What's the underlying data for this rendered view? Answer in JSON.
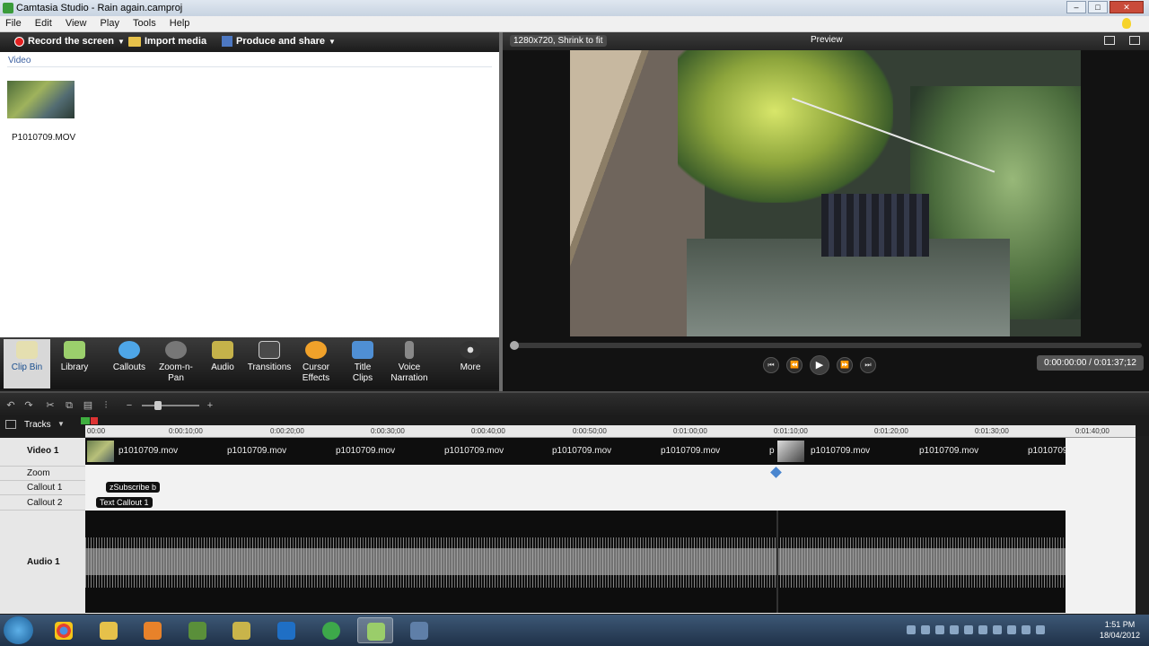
{
  "window": {
    "title": "Camtasia Studio - Rain again.camproj"
  },
  "menu": [
    "File",
    "Edit",
    "View",
    "Play",
    "Tools",
    "Help"
  ],
  "toolbar": {
    "record": "Record the screen",
    "import": "Import media",
    "produce": "Produce and share"
  },
  "clip_bin": {
    "section": "Video",
    "items": [
      {
        "name": "P1010709.MOV"
      }
    ]
  },
  "tasks": [
    {
      "label": "Clip Bin"
    },
    {
      "label": "Library"
    },
    {
      "label": "Callouts"
    },
    {
      "label": "Zoom-n-\nPan"
    },
    {
      "label": "Audio"
    },
    {
      "label": "Transitions"
    },
    {
      "label": "Cursor\nEffects"
    },
    {
      "label": "Title\nClips"
    },
    {
      "label": "Voice\nNarration"
    },
    {
      "label": "More"
    }
  ],
  "preview": {
    "resolution": "1280x720, Shrink to fit",
    "title": "Preview",
    "time": "0:00:00:00 / 0:01:37;12",
    "progress": 0.0
  },
  "timeline": {
    "tracks_label": "Tracks",
    "ticks": [
      "00:00",
      "0:00:10;00",
      "0:00:20;00",
      "0:00:30;00",
      "0:00:40;00",
      "0:00:50;00",
      "0:01:00;00",
      "0:01:10;00",
      "0:01:20;00",
      "0:01:30;00",
      "0:01:40;00"
    ],
    "tracks": [
      "Video 1",
      "Zoom",
      "Callout 1",
      "Callout 2",
      "Audio 1"
    ],
    "video_clips": [
      "p1010709.mov",
      "p1010709.mov",
      "p1010709.mov",
      "p1010709.mov",
      "p1010709.mov",
      "p1010709.mov",
      "p",
      "p1010709.mov",
      "p1010709.mov",
      "p1010709"
    ],
    "callout1": "zSubscribe b",
    "callout2": "Text Callout 1"
  },
  "taskbar": {
    "time": "1:51 PM",
    "date": "18/04/2012"
  }
}
